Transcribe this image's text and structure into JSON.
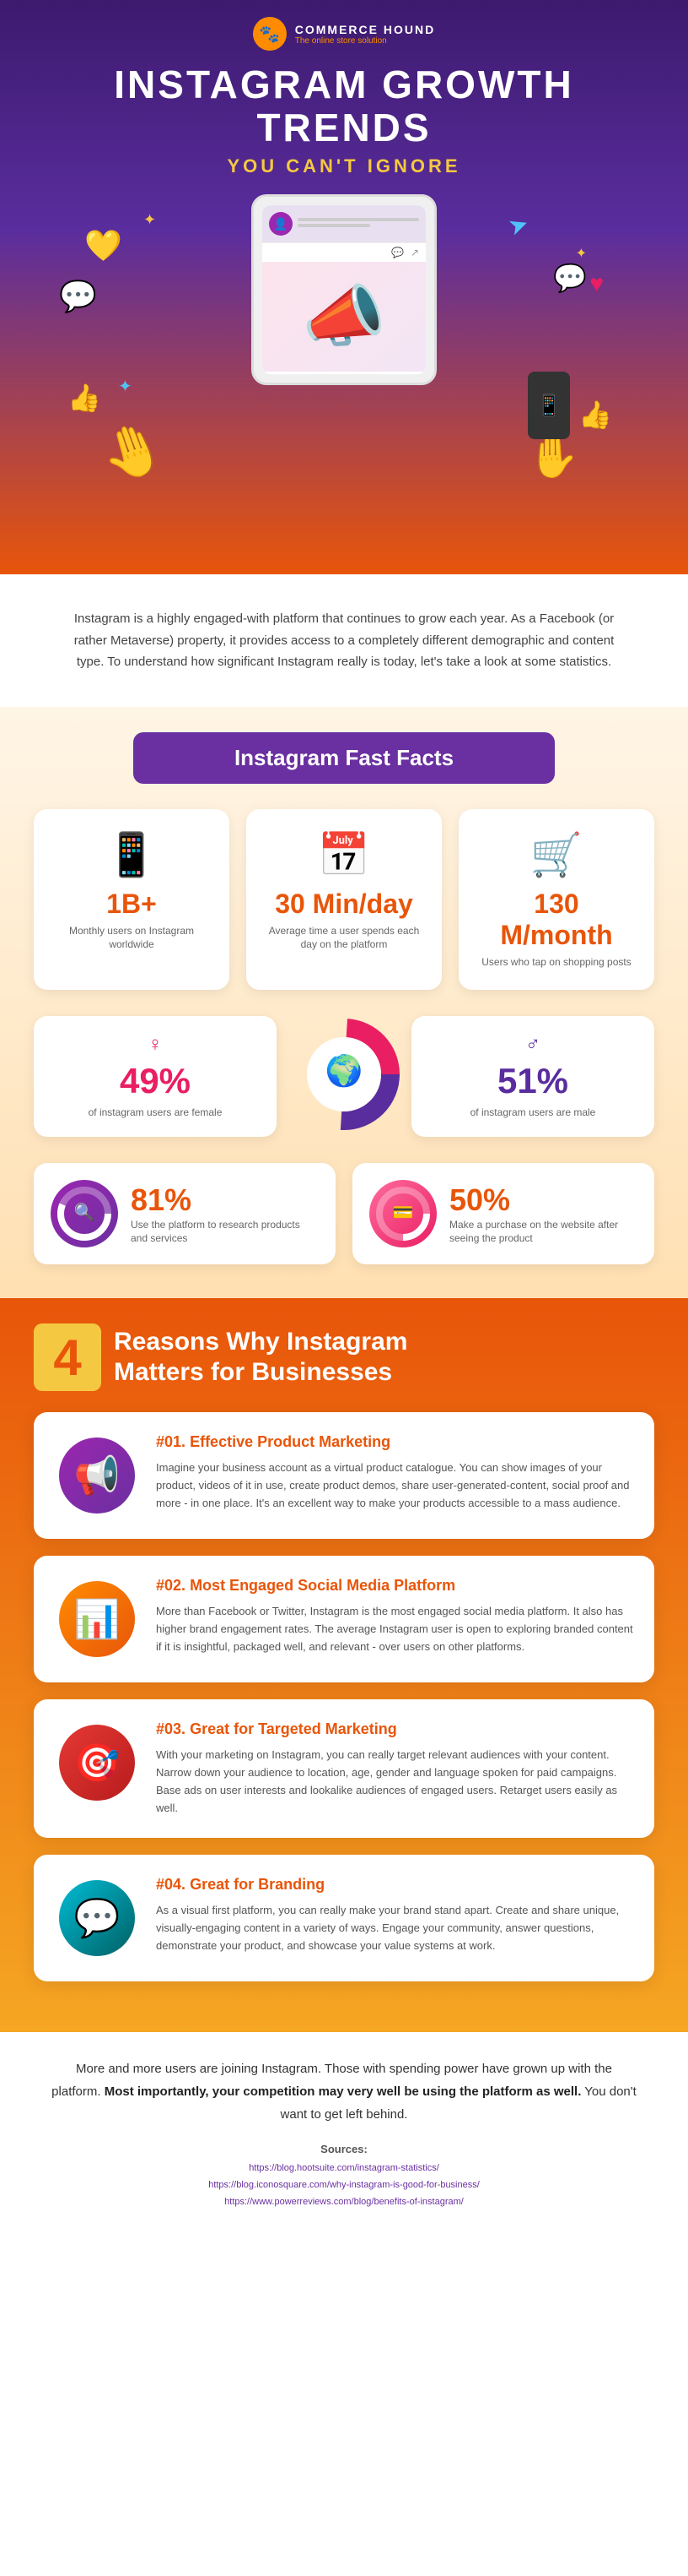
{
  "brand": {
    "logo_emoji": "🐾",
    "name": "COMMERCE HOUND",
    "tagline": "The online store solution"
  },
  "header": {
    "main_title": "INSTAGRAM GROWTH TRENDS",
    "sub_title": "YOU CAN'T IGNORE"
  },
  "intro": {
    "text": "Instagram is a highly engaged-with platform that continues to grow each year. As a Facebook (or rather Metaverse) property, it provides access to a completely different demographic and content type. To understand how significant Instagram really is today, let's take a look at some statistics."
  },
  "fast_facts": {
    "section_title": "Instagram Fast Facts",
    "stats": [
      {
        "icon": "📱",
        "number": "1B+",
        "label": "Monthly users on Instagram worldwide"
      },
      {
        "icon": "📅",
        "number": "30 Min/day",
        "label": "Average time a user spends each day on the platform"
      },
      {
        "icon": "🛒",
        "number": "130 M/month",
        "label": "Users who tap on shopping posts"
      }
    ],
    "gender": {
      "female_pct": "49%",
      "female_label": "of instagram users are female",
      "female_icon": "♀",
      "male_pct": "51%",
      "male_label": "of instagram users are male",
      "male_icon": "♂",
      "female_color": "#e91e63",
      "male_color": "#5a2d9e"
    },
    "bottom_stats": [
      {
        "icon": "🔍",
        "pct": "81%",
        "desc": "Use the platform to research products and services",
        "color_class": "purple"
      },
      {
        "icon": "💳",
        "pct": "50%",
        "desc": "Make a purchase on the website after seeing the product",
        "color_class": "pink"
      }
    ]
  },
  "reasons": {
    "section_number": "4",
    "section_title": "Reasons Why Instagram\nMatters for Businesses",
    "items": [
      {
        "id": "#01.",
        "title": "Effective Product Marketing",
        "text": "Imagine your business account as a virtual product catalogue. You can show images of your product, videos of it in use, create product demos, share user-generated-content, social proof and more - in one place. It's an excellent way to make your products accessible to a mass audience.",
        "icon": "📢",
        "color_class": "purple-grad"
      },
      {
        "id": "#02.",
        "title": "Most Engaged Social Media Platform",
        "text": "More than Facebook or Twitter, Instagram is the most engaged social media platform. It also has higher brand engagement rates. The average Instagram user is open to exploring branded content if it is insightful, packaged well, and relevant - over users on other platforms.",
        "icon": "📊",
        "color_class": "orange-grad"
      },
      {
        "id": "#03.",
        "title": "Great for Targeted Marketing",
        "text": "With your marketing on Instagram, you can really target relevant audiences with your content. Narrow down your audience to location, age, gender and language spoken for paid campaigns. Base ads on user interests and lookalike audiences of engaged users. Retarget users easily as well.",
        "icon": "🎯",
        "color_class": "red-grad"
      },
      {
        "id": "#04.",
        "title": "Great for Branding",
        "text": "As a visual first platform, you can really make your brand stand apart. Create and share unique, visually-engaging content in a variety of ways. Engage your community, answer questions, demonstrate your product, and showcase your value systems at work.",
        "icon": "💬",
        "color_class": "teal-grad"
      }
    ]
  },
  "footer": {
    "text_parts": [
      "More and more users are joining Instagram. Those with spending power have grown up with the platform. ",
      "Most importantly, your competition may very well be using the platform as well. ",
      "You don't want to get left behind."
    ],
    "sources_label": "Sources:",
    "sources": [
      "https://blog.hootsuite.com/instagram-statistics/",
      "https://blog.iconosquare.com/why-instagram-is-good-for-business/",
      "https://www.powerreviews.com/blog/benefits-of-instagram/"
    ]
  }
}
